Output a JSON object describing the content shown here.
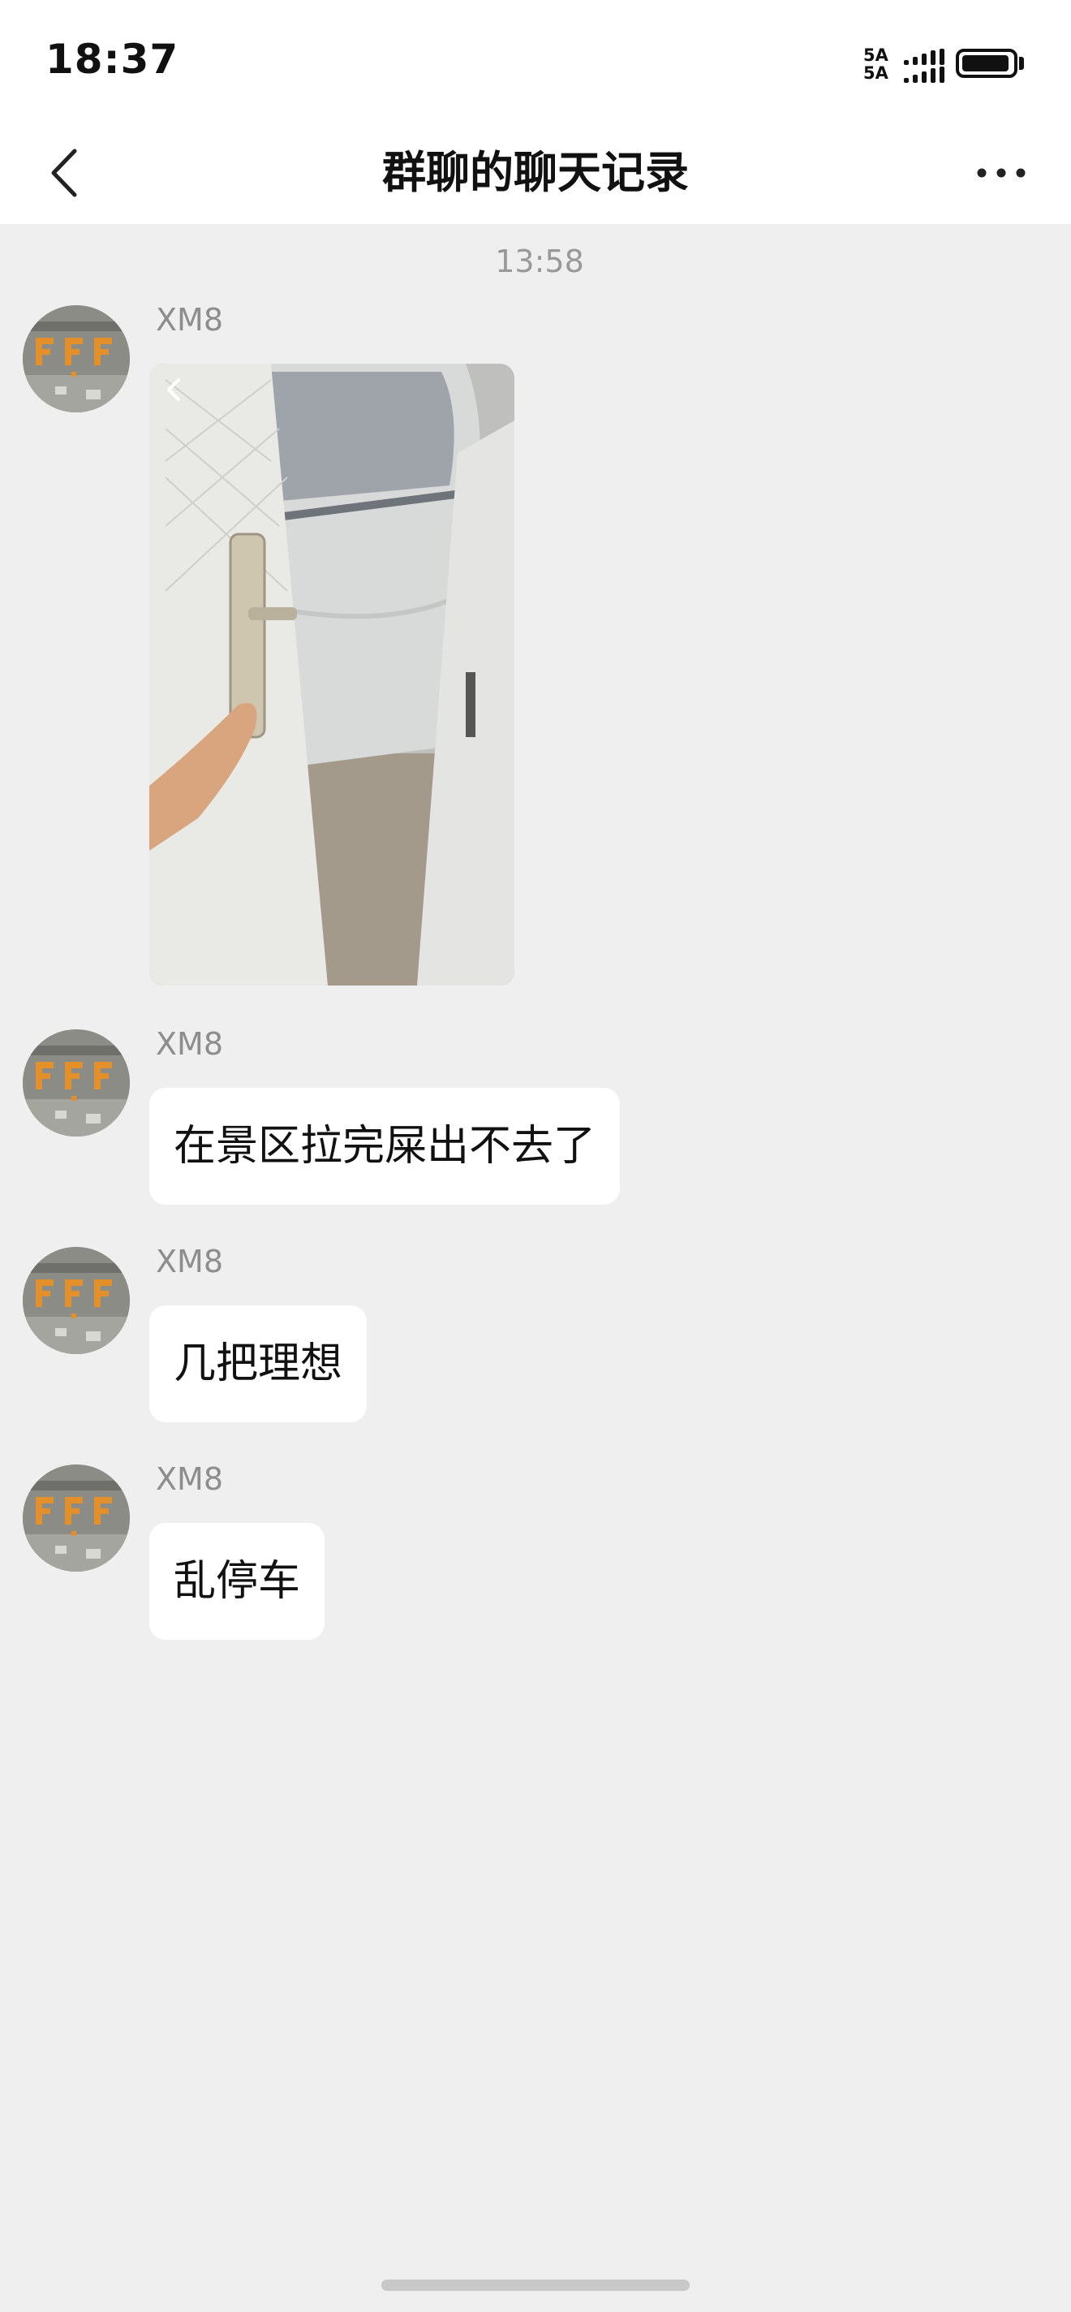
{
  "status_bar": {
    "time": "18:37",
    "signal_label_top": "5A",
    "signal_label_bottom": "5A",
    "battery_level": 0.95
  },
  "nav": {
    "title": "群聊的聊天记录",
    "back_icon": "chevron-left-icon",
    "more_icon": "more-dots-icon"
  },
  "chat": {
    "timestamp": "13:58",
    "messages": [
      {
        "sender": "XM8",
        "type": "image"
      },
      {
        "sender": "XM8",
        "type": "text",
        "text": "在景区拉完屎出不去了"
      },
      {
        "sender": "XM8",
        "type": "text",
        "text": "几把理想"
      },
      {
        "sender": "XM8",
        "type": "text",
        "text": "乱停车"
      }
    ]
  },
  "colors": {
    "background": "#efefef",
    "bar": "#ffffff",
    "bubble": "#ffffff",
    "sender": "#8d8d8d",
    "timestamp": "#999999"
  }
}
